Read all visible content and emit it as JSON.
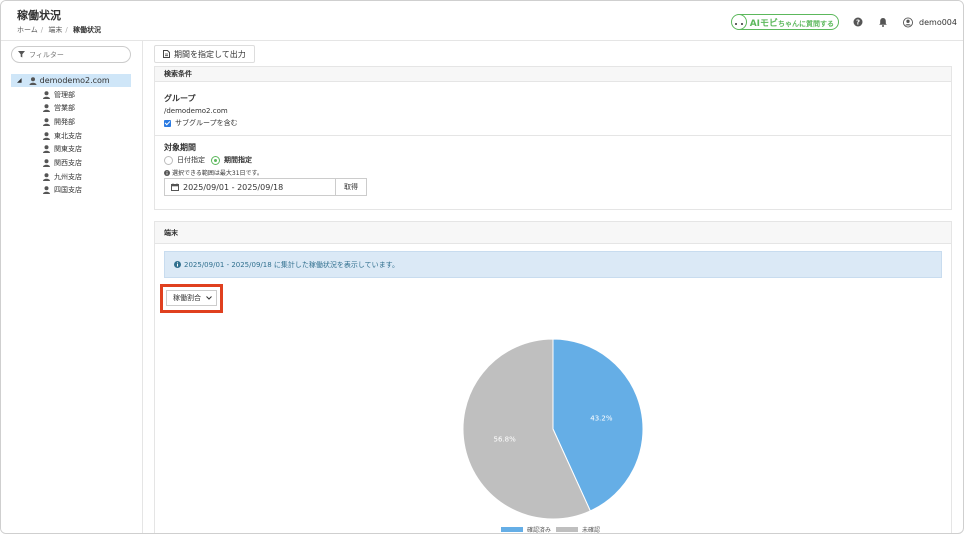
{
  "header": {
    "title": "稼働状況",
    "breadcrumb": [
      "ホーム",
      "端末",
      "稼働状況"
    ],
    "ai_logo_main": "AIモビ",
    "ai_logo_sub": "ちゃんに質問する",
    "username": "demo004"
  },
  "sidebar": {
    "filter_placeholder": "フィルター",
    "root_label": "demodemo2.com",
    "children": [
      "管理部",
      "営業部",
      "開発部",
      "東北支店",
      "関東支店",
      "関西支店",
      "九州支店",
      "四国支店"
    ]
  },
  "toolbar": {
    "export_label": "期間を指定して出力"
  },
  "search": {
    "panel_title": "検索条件",
    "group_title": "グループ",
    "group_value": "/demodemo2.com",
    "subgroup_label": "サブグループを含む",
    "period_title": "対象期間",
    "radio_date": "日付指定",
    "radio_period": "期間指定",
    "note": "選択できる範囲は最大31日です。",
    "date_range": "2025/09/01 - 2025/09/18",
    "get_label": "取得"
  },
  "terminal": {
    "panel_title": "端末",
    "info": "2025/09/01 - 2025/09/18 に集計した稼働状況を表示しています。",
    "select_value": "稼働割合"
  },
  "colors": {
    "confirmed": "#65aee6",
    "unconfirmed": "#bfbfbf",
    "accent_green": "#5cb85c",
    "highlight_red": "#e0401f"
  },
  "chart_data": {
    "type": "pie",
    "categories": [
      "確認済み",
      "未確認"
    ],
    "values": [
      43.2,
      56.8
    ],
    "labels": [
      "43.2%",
      "56.8%"
    ],
    "legend_position": "bottom"
  }
}
